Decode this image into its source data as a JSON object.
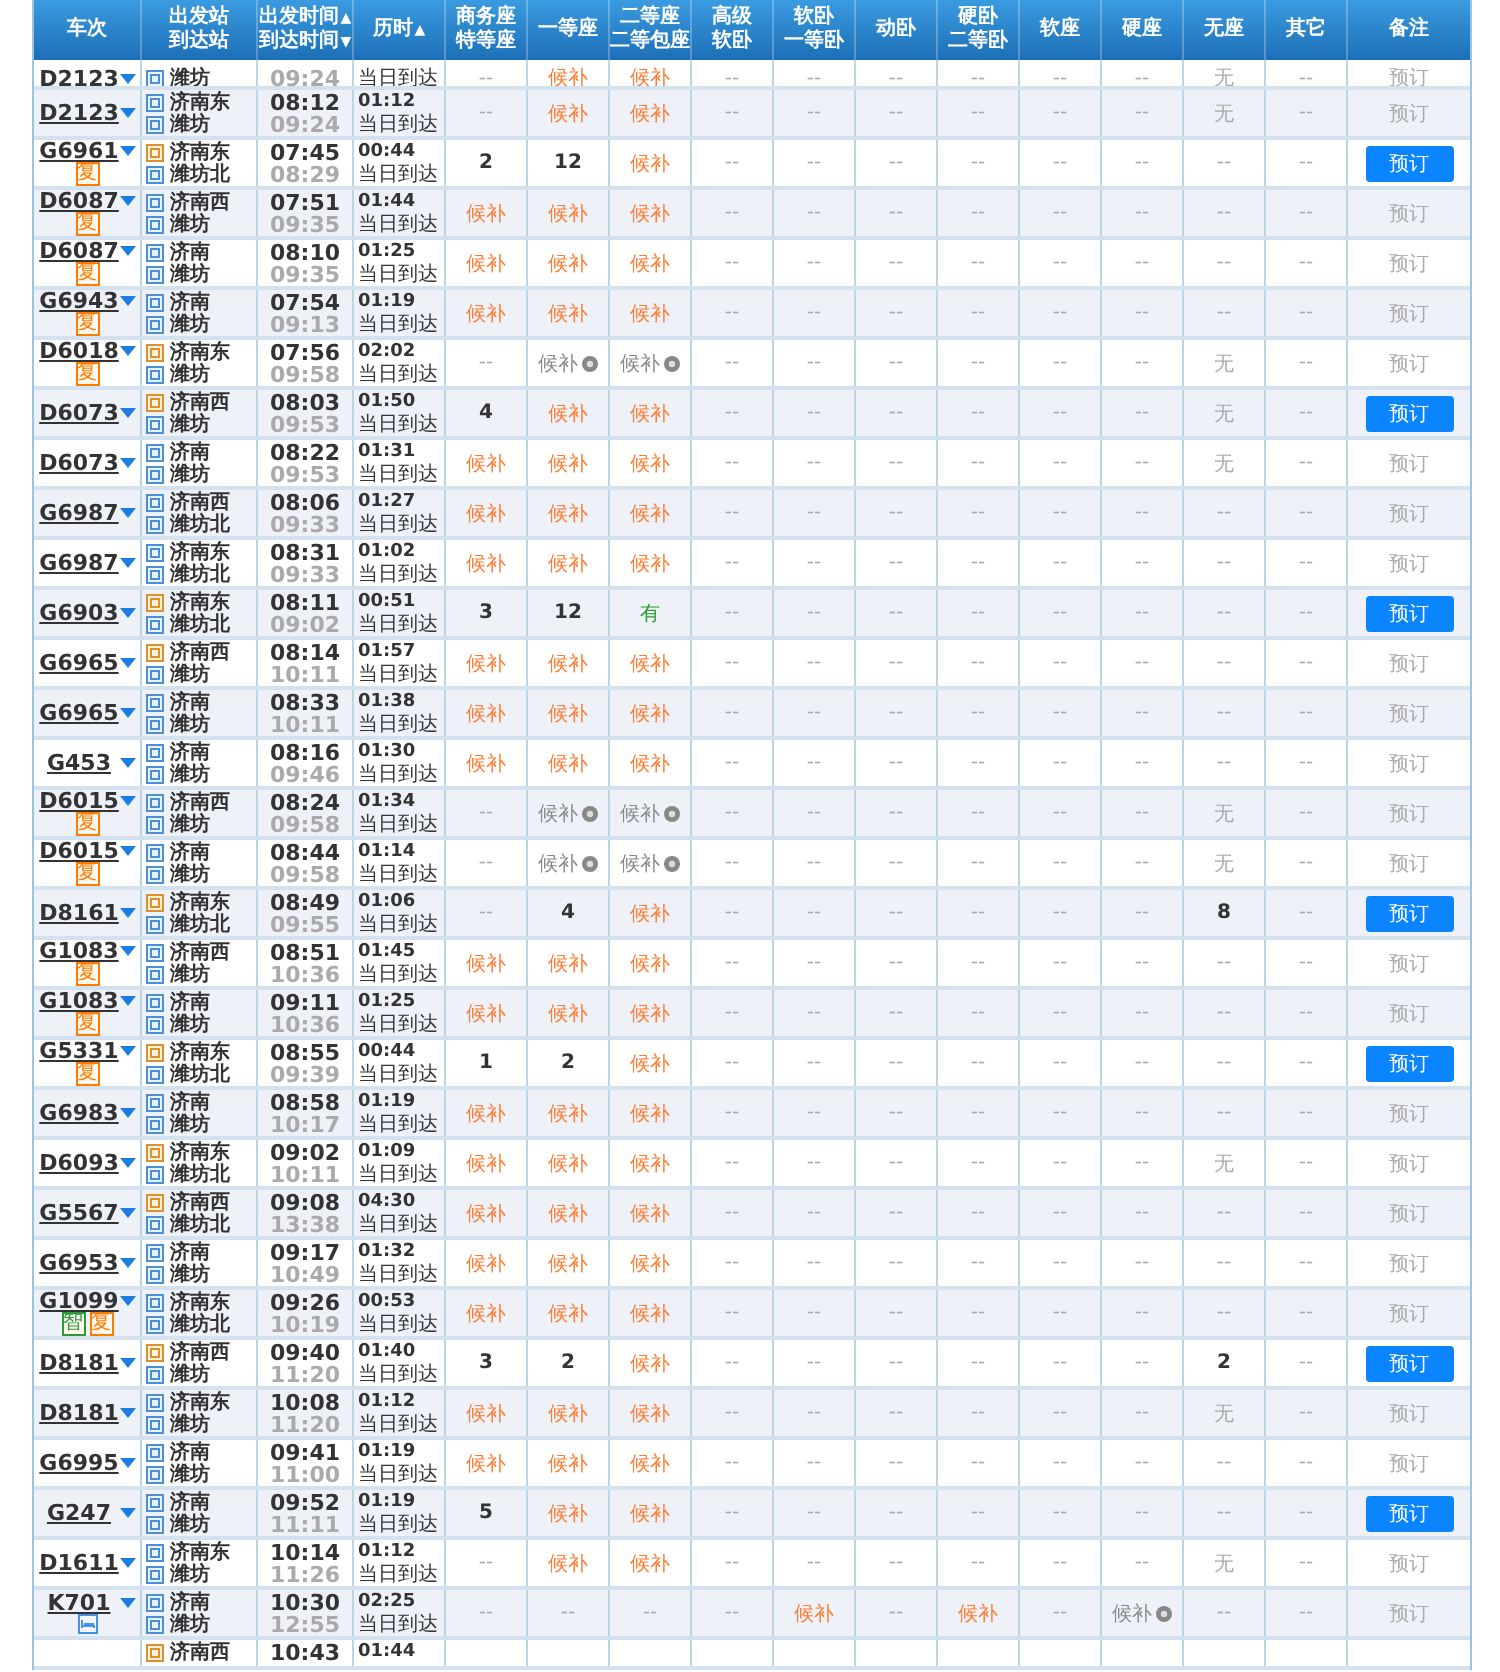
{
  "columns": [
    {
      "lines": [
        {
          "text": "车次"
        }
      ]
    },
    {
      "lines": [
        {
          "text": "出发站"
        },
        {
          "text": "到达站"
        }
      ]
    },
    {
      "lines": [
        {
          "text": "出发时间",
          "sort": "▲"
        },
        {
          "text": "到达时间",
          "sort": "▼"
        }
      ]
    },
    {
      "lines": [
        {
          "text": "历时",
          "sort": "▲"
        }
      ]
    },
    {
      "lines": [
        {
          "text": "商务座"
        },
        {
          "text": "特等座"
        }
      ]
    },
    {
      "lines": [
        {
          "text": "一等座"
        }
      ]
    },
    {
      "lines": [
        {
          "text": "二等座"
        },
        {
          "text": "二等包座"
        }
      ]
    },
    {
      "lines": [
        {
          "text": "高级"
        },
        {
          "text": "软卧"
        }
      ]
    },
    {
      "lines": [
        {
          "text": "软卧"
        },
        {
          "text": "一等卧"
        }
      ]
    },
    {
      "lines": [
        {
          "text": "动卧"
        }
      ]
    },
    {
      "lines": [
        {
          "text": "硬卧"
        },
        {
          "text": "二等卧"
        }
      ]
    },
    {
      "lines": [
        {
          "text": "软座"
        }
      ]
    },
    {
      "lines": [
        {
          "text": "硬座"
        }
      ]
    },
    {
      "lines": [
        {
          "text": "无座"
        }
      ]
    },
    {
      "lines": [
        {
          "text": "其它"
        }
      ]
    },
    {
      "lines": [
        {
          "text": "备注"
        }
      ]
    }
  ],
  "rows": [
    {
      "train": "D2123",
      "badges": [],
      "to": {
        "name": "潍坊",
        "kind": "pass"
      },
      "arrive": "09:24",
      "note": "当日到达",
      "seats": [
        {
          "text": "--",
          "kind": "none"
        },
        {
          "text": "候补",
          "kind": "wait"
        },
        {
          "text": "候补",
          "kind": "wait"
        },
        {
          "text": "--",
          "kind": "none"
        },
        {
          "text": "--",
          "kind": "none"
        },
        {
          "text": "--",
          "kind": "none"
        },
        {
          "text": "--",
          "kind": "none"
        },
        {
          "text": "--",
          "kind": "none"
        },
        {
          "text": "--",
          "kind": "none"
        },
        {
          "text": "无",
          "kind": "none"
        },
        {
          "text": "--",
          "kind": "none"
        }
      ],
      "book": {
        "label": "预订",
        "enabled": false
      }
    },
    {
      "train": "D2123",
      "badges": [],
      "from": {
        "name": "济南东",
        "kind": "pass"
      },
      "to": {
        "name": "潍坊",
        "kind": "pass"
      },
      "depart": "08:12",
      "arrive": "09:24",
      "duration": "01:12",
      "note": "当日到达",
      "seats": [
        {
          "text": "--",
          "kind": "none"
        },
        {
          "text": "候补",
          "kind": "wait"
        },
        {
          "text": "候补",
          "kind": "wait"
        },
        {
          "text": "--",
          "kind": "none"
        },
        {
          "text": "--",
          "kind": "none"
        },
        {
          "text": "--",
          "kind": "none"
        },
        {
          "text": "--",
          "kind": "none"
        },
        {
          "text": "--",
          "kind": "none"
        },
        {
          "text": "--",
          "kind": "none"
        },
        {
          "text": "无",
          "kind": "none"
        },
        {
          "text": "--",
          "kind": "none"
        }
      ],
      "book": {
        "label": "预订",
        "enabled": false
      }
    },
    {
      "train": "G6961",
      "badges": [
        {
          "text": "复",
          "color": "#ff7a00"
        }
      ],
      "from": {
        "name": "济南东",
        "kind": "start"
      },
      "to": {
        "name": "潍坊北",
        "kind": "pass"
      },
      "depart": "07:45",
      "arrive": "08:29",
      "duration": "00:44",
      "note": "当日到达",
      "seats": [
        {
          "text": "2",
          "kind": "count"
        },
        {
          "text": "12",
          "kind": "count"
        },
        {
          "text": "候补",
          "kind": "wait"
        },
        {
          "text": "--",
          "kind": "none"
        },
        {
          "text": "--",
          "kind": "none"
        },
        {
          "text": "--",
          "kind": "none"
        },
        {
          "text": "--",
          "kind": "none"
        },
        {
          "text": "--",
          "kind": "none"
        },
        {
          "text": "--",
          "kind": "none"
        },
        {
          "text": "--",
          "kind": "none"
        },
        {
          "text": "--",
          "kind": "none"
        }
      ],
      "book": {
        "label": "预订",
        "enabled": true
      }
    },
    {
      "train": "D6087",
      "badges": [
        {
          "text": "复",
          "color": "#ff7a00"
        }
      ],
      "from": {
        "name": "济南西",
        "kind": "pass"
      },
      "to": {
        "name": "潍坊",
        "kind": "pass"
      },
      "depart": "07:51",
      "arrive": "09:35",
      "duration": "01:44",
      "note": "当日到达",
      "seats": [
        {
          "text": "候补",
          "kind": "wait"
        },
        {
          "text": "候补",
          "kind": "wait"
        },
        {
          "text": "候补",
          "kind": "wait"
        },
        {
          "text": "--",
          "kind": "none"
        },
        {
          "text": "--",
          "kind": "none"
        },
        {
          "text": "--",
          "kind": "none"
        },
        {
          "text": "--",
          "kind": "none"
        },
        {
          "text": "--",
          "kind": "none"
        },
        {
          "text": "--",
          "kind": "none"
        },
        {
          "text": "--",
          "kind": "none"
        },
        {
          "text": "--",
          "kind": "none"
        }
      ],
      "book": {
        "label": "预订",
        "enabled": false
      }
    },
    {
      "train": "D6087",
      "badges": [
        {
          "text": "复",
          "color": "#ff7a00"
        }
      ],
      "from": {
        "name": "济南",
        "kind": "pass"
      },
      "to": {
        "name": "潍坊",
        "kind": "pass"
      },
      "depart": "08:10",
      "arrive": "09:35",
      "duration": "01:25",
      "note": "当日到达",
      "seats": [
        {
          "text": "候补",
          "kind": "wait"
        },
        {
          "text": "候补",
          "kind": "wait"
        },
        {
          "text": "候补",
          "kind": "wait"
        },
        {
          "text": "--",
          "kind": "none"
        },
        {
          "text": "--",
          "kind": "none"
        },
        {
          "text": "--",
          "kind": "none"
        },
        {
          "text": "--",
          "kind": "none"
        },
        {
          "text": "--",
          "kind": "none"
        },
        {
          "text": "--",
          "kind": "none"
        },
        {
          "text": "--",
          "kind": "none"
        },
        {
          "text": "--",
          "kind": "none"
        }
      ],
      "book": {
        "label": "预订",
        "enabled": false
      }
    },
    {
      "train": "G6943",
      "badges": [
        {
          "text": "复",
          "color": "#ff7a00"
        }
      ],
      "from": {
        "name": "济南",
        "kind": "pass"
      },
      "to": {
        "name": "潍坊",
        "kind": "pass"
      },
      "depart": "07:54",
      "arrive": "09:13",
      "duration": "01:19",
      "note": "当日到达",
      "seats": [
        {
          "text": "候补",
          "kind": "wait"
        },
        {
          "text": "候补",
          "kind": "wait"
        },
        {
          "text": "候补",
          "kind": "wait"
        },
        {
          "text": "--",
          "kind": "none"
        },
        {
          "text": "--",
          "kind": "none"
        },
        {
          "text": "--",
          "kind": "none"
        },
        {
          "text": "--",
          "kind": "none"
        },
        {
          "text": "--",
          "kind": "none"
        },
        {
          "text": "--",
          "kind": "none"
        },
        {
          "text": "--",
          "kind": "none"
        },
        {
          "text": "--",
          "kind": "none"
        }
      ],
      "book": {
        "label": "预订",
        "enabled": false
      }
    },
    {
      "train": "D6018",
      "badges": [
        {
          "text": "复",
          "color": "#ff7a00"
        }
      ],
      "from": {
        "name": "济南东",
        "kind": "start"
      },
      "to": {
        "name": "潍坊",
        "kind": "pass"
      },
      "depart": "07:56",
      "arrive": "09:58",
      "duration": "02:02",
      "note": "当日到达",
      "seats": [
        {
          "text": "--",
          "kind": "none"
        },
        {
          "text": "候补",
          "kind": "closed"
        },
        {
          "text": "候补",
          "kind": "closed"
        },
        {
          "text": "--",
          "kind": "none"
        },
        {
          "text": "--",
          "kind": "none"
        },
        {
          "text": "--",
          "kind": "none"
        },
        {
          "text": "--",
          "kind": "none"
        },
        {
          "text": "--",
          "kind": "none"
        },
        {
          "text": "--",
          "kind": "none"
        },
        {
          "text": "无",
          "kind": "none"
        },
        {
          "text": "--",
          "kind": "none"
        }
      ],
      "book": {
        "label": "预订",
        "enabled": false
      }
    },
    {
      "train": "D6073",
      "badges": [],
      "from": {
        "name": "济南西",
        "kind": "start"
      },
      "to": {
        "name": "潍坊",
        "kind": "pass"
      },
      "depart": "08:03",
      "arrive": "09:53",
      "duration": "01:50",
      "note": "当日到达",
      "seats": [
        {
          "text": "4",
          "kind": "count"
        },
        {
          "text": "候补",
          "kind": "wait"
        },
        {
          "text": "候补",
          "kind": "wait"
        },
        {
          "text": "--",
          "kind": "none"
        },
        {
          "text": "--",
          "kind": "none"
        },
        {
          "text": "--",
          "kind": "none"
        },
        {
          "text": "--",
          "kind": "none"
        },
        {
          "text": "--",
          "kind": "none"
        },
        {
          "text": "--",
          "kind": "none"
        },
        {
          "text": "无",
          "kind": "none"
        },
        {
          "text": "--",
          "kind": "none"
        }
      ],
      "book": {
        "label": "预订",
        "enabled": true
      }
    },
    {
      "train": "D6073",
      "badges": [],
      "from": {
        "name": "济南",
        "kind": "pass"
      },
      "to": {
        "name": "潍坊",
        "kind": "pass"
      },
      "depart": "08:22",
      "arrive": "09:53",
      "duration": "01:31",
      "note": "当日到达",
      "seats": [
        {
          "text": "候补",
          "kind": "wait"
        },
        {
          "text": "候补",
          "kind": "wait"
        },
        {
          "text": "候补",
          "kind": "wait"
        },
        {
          "text": "--",
          "kind": "none"
        },
        {
          "text": "--",
          "kind": "none"
        },
        {
          "text": "--",
          "kind": "none"
        },
        {
          "text": "--",
          "kind": "none"
        },
        {
          "text": "--",
          "kind": "none"
        },
        {
          "text": "--",
          "kind": "none"
        },
        {
          "text": "无",
          "kind": "none"
        },
        {
          "text": "--",
          "kind": "none"
        }
      ],
      "book": {
        "label": "预订",
        "enabled": false
      }
    },
    {
      "train": "G6987",
      "badges": [],
      "from": {
        "name": "济南西",
        "kind": "pass"
      },
      "to": {
        "name": "潍坊北",
        "kind": "pass"
      },
      "depart": "08:06",
      "arrive": "09:33",
      "duration": "01:27",
      "note": "当日到达",
      "seats": [
        {
          "text": "候补",
          "kind": "wait"
        },
        {
          "text": "候补",
          "kind": "wait"
        },
        {
          "text": "候补",
          "kind": "wait"
        },
        {
          "text": "--",
          "kind": "none"
        },
        {
          "text": "--",
          "kind": "none"
        },
        {
          "text": "--",
          "kind": "none"
        },
        {
          "text": "--",
          "kind": "none"
        },
        {
          "text": "--",
          "kind": "none"
        },
        {
          "text": "--",
          "kind": "none"
        },
        {
          "text": "--",
          "kind": "none"
        },
        {
          "text": "--",
          "kind": "none"
        }
      ],
      "book": {
        "label": "预订",
        "enabled": false
      }
    },
    {
      "train": "G6987",
      "badges": [],
      "from": {
        "name": "济南东",
        "kind": "pass"
      },
      "to": {
        "name": "潍坊北",
        "kind": "pass"
      },
      "depart": "08:31",
      "arrive": "09:33",
      "duration": "01:02",
      "note": "当日到达",
      "seats": [
        {
          "text": "候补",
          "kind": "wait"
        },
        {
          "text": "候补",
          "kind": "wait"
        },
        {
          "text": "候补",
          "kind": "wait"
        },
        {
          "text": "--",
          "kind": "none"
        },
        {
          "text": "--",
          "kind": "none"
        },
        {
          "text": "--",
          "kind": "none"
        },
        {
          "text": "--",
          "kind": "none"
        },
        {
          "text": "--",
          "kind": "none"
        },
        {
          "text": "--",
          "kind": "none"
        },
        {
          "text": "--",
          "kind": "none"
        },
        {
          "text": "--",
          "kind": "none"
        }
      ],
      "book": {
        "label": "预订",
        "enabled": false
      }
    },
    {
      "train": "G6903",
      "badges": [],
      "from": {
        "name": "济南东",
        "kind": "start"
      },
      "to": {
        "name": "潍坊北",
        "kind": "pass"
      },
      "depart": "08:11",
      "arrive": "09:02",
      "duration": "00:51",
      "note": "当日到达",
      "seats": [
        {
          "text": "3",
          "kind": "count"
        },
        {
          "text": "12",
          "kind": "count"
        },
        {
          "text": "有",
          "kind": "available"
        },
        {
          "text": "--",
          "kind": "none"
        },
        {
          "text": "--",
          "kind": "none"
        },
        {
          "text": "--",
          "kind": "none"
        },
        {
          "text": "--",
          "kind": "none"
        },
        {
          "text": "--",
          "kind": "none"
        },
        {
          "text": "--",
          "kind": "none"
        },
        {
          "text": "--",
          "kind": "none"
        },
        {
          "text": "--",
          "kind": "none"
        }
      ],
      "book": {
        "label": "预订",
        "enabled": true
      }
    },
    {
      "train": "G6965",
      "badges": [],
      "from": {
        "name": "济南西",
        "kind": "start"
      },
      "to": {
        "name": "潍坊",
        "kind": "pass"
      },
      "depart": "08:14",
      "arrive": "10:11",
      "duration": "01:57",
      "note": "当日到达",
      "seats": [
        {
          "text": "候补",
          "kind": "wait"
        },
        {
          "text": "候补",
          "kind": "wait"
        },
        {
          "text": "候补",
          "kind": "wait"
        },
        {
          "text": "--",
          "kind": "none"
        },
        {
          "text": "--",
          "kind": "none"
        },
        {
          "text": "--",
          "kind": "none"
        },
        {
          "text": "--",
          "kind": "none"
        },
        {
          "text": "--",
          "kind": "none"
        },
        {
          "text": "--",
          "kind": "none"
        },
        {
          "text": "--",
          "kind": "none"
        },
        {
          "text": "--",
          "kind": "none"
        }
      ],
      "book": {
        "label": "预订",
        "enabled": false
      }
    },
    {
      "train": "G6965",
      "badges": [],
      "from": {
        "name": "济南",
        "kind": "pass"
      },
      "to": {
        "name": "潍坊",
        "kind": "pass"
      },
      "depart": "08:33",
      "arrive": "10:11",
      "duration": "01:38",
      "note": "当日到达",
      "seats": [
        {
          "text": "候补",
          "kind": "wait"
        },
        {
          "text": "候补",
          "kind": "wait"
        },
        {
          "text": "候补",
          "kind": "wait"
        },
        {
          "text": "--",
          "kind": "none"
        },
        {
          "text": "--",
          "kind": "none"
        },
        {
          "text": "--",
          "kind": "none"
        },
        {
          "text": "--",
          "kind": "none"
        },
        {
          "text": "--",
          "kind": "none"
        },
        {
          "text": "--",
          "kind": "none"
        },
        {
          "text": "--",
          "kind": "none"
        },
        {
          "text": "--",
          "kind": "none"
        }
      ],
      "book": {
        "label": "预订",
        "enabled": false
      }
    },
    {
      "train": "G453",
      "badges": [],
      "from": {
        "name": "济南",
        "kind": "pass"
      },
      "to": {
        "name": "潍坊",
        "kind": "pass"
      },
      "depart": "08:16",
      "arrive": "09:46",
      "duration": "01:30",
      "note": "当日到达",
      "seats": [
        {
          "text": "候补",
          "kind": "wait"
        },
        {
          "text": "候补",
          "kind": "wait"
        },
        {
          "text": "候补",
          "kind": "wait"
        },
        {
          "text": "--",
          "kind": "none"
        },
        {
          "text": "--",
          "kind": "none"
        },
        {
          "text": "--",
          "kind": "none"
        },
        {
          "text": "--",
          "kind": "none"
        },
        {
          "text": "--",
          "kind": "none"
        },
        {
          "text": "--",
          "kind": "none"
        },
        {
          "text": "--",
          "kind": "none"
        },
        {
          "text": "--",
          "kind": "none"
        }
      ],
      "book": {
        "label": "预订",
        "enabled": false
      }
    },
    {
      "train": "D6015",
      "badges": [
        {
          "text": "复",
          "color": "#ff7a00"
        }
      ],
      "from": {
        "name": "济南西",
        "kind": "pass"
      },
      "to": {
        "name": "潍坊",
        "kind": "pass"
      },
      "depart": "08:24",
      "arrive": "09:58",
      "duration": "01:34",
      "note": "当日到达",
      "seats": [
        {
          "text": "--",
          "kind": "none"
        },
        {
          "text": "候补",
          "kind": "closed"
        },
        {
          "text": "候补",
          "kind": "closed"
        },
        {
          "text": "--",
          "kind": "none"
        },
        {
          "text": "--",
          "kind": "none"
        },
        {
          "text": "--",
          "kind": "none"
        },
        {
          "text": "--",
          "kind": "none"
        },
        {
          "text": "--",
          "kind": "none"
        },
        {
          "text": "--",
          "kind": "none"
        },
        {
          "text": "无",
          "kind": "none"
        },
        {
          "text": "--",
          "kind": "none"
        }
      ],
      "book": {
        "label": "预订",
        "enabled": false
      }
    },
    {
      "train": "D6015",
      "badges": [
        {
          "text": "复",
          "color": "#ff7a00"
        }
      ],
      "from": {
        "name": "济南",
        "kind": "pass"
      },
      "to": {
        "name": "潍坊",
        "kind": "pass"
      },
      "depart": "08:44",
      "arrive": "09:58",
      "duration": "01:14",
      "note": "当日到达",
      "seats": [
        {
          "text": "--",
          "kind": "none"
        },
        {
          "text": "候补",
          "kind": "closed"
        },
        {
          "text": "候补",
          "kind": "closed"
        },
        {
          "text": "--",
          "kind": "none"
        },
        {
          "text": "--",
          "kind": "none"
        },
        {
          "text": "--",
          "kind": "none"
        },
        {
          "text": "--",
          "kind": "none"
        },
        {
          "text": "--",
          "kind": "none"
        },
        {
          "text": "--",
          "kind": "none"
        },
        {
          "text": "无",
          "kind": "none"
        },
        {
          "text": "--",
          "kind": "none"
        }
      ],
      "book": {
        "label": "预订",
        "enabled": false
      }
    },
    {
      "train": "D8161",
      "badges": [],
      "from": {
        "name": "济南东",
        "kind": "start"
      },
      "to": {
        "name": "潍坊北",
        "kind": "pass"
      },
      "depart": "08:49",
      "arrive": "09:55",
      "duration": "01:06",
      "note": "当日到达",
      "seats": [
        {
          "text": "--",
          "kind": "none"
        },
        {
          "text": "4",
          "kind": "count"
        },
        {
          "text": "候补",
          "kind": "wait"
        },
        {
          "text": "--",
          "kind": "none"
        },
        {
          "text": "--",
          "kind": "none"
        },
        {
          "text": "--",
          "kind": "none"
        },
        {
          "text": "--",
          "kind": "none"
        },
        {
          "text": "--",
          "kind": "none"
        },
        {
          "text": "--",
          "kind": "none"
        },
        {
          "text": "8",
          "kind": "count"
        },
        {
          "text": "--",
          "kind": "none"
        }
      ],
      "book": {
        "label": "预订",
        "enabled": true
      }
    },
    {
      "train": "G1083",
      "badges": [
        {
          "text": "复",
          "color": "#ff7a00"
        }
      ],
      "from": {
        "name": "济南西",
        "kind": "pass"
      },
      "to": {
        "name": "潍坊",
        "kind": "pass"
      },
      "depart": "08:51",
      "arrive": "10:36",
      "duration": "01:45",
      "note": "当日到达",
      "seats": [
        {
          "text": "候补",
          "kind": "wait"
        },
        {
          "text": "候补",
          "kind": "wait"
        },
        {
          "text": "候补",
          "kind": "wait"
        },
        {
          "text": "--",
          "kind": "none"
        },
        {
          "text": "--",
          "kind": "none"
        },
        {
          "text": "--",
          "kind": "none"
        },
        {
          "text": "--",
          "kind": "none"
        },
        {
          "text": "--",
          "kind": "none"
        },
        {
          "text": "--",
          "kind": "none"
        },
        {
          "text": "--",
          "kind": "none"
        },
        {
          "text": "--",
          "kind": "none"
        }
      ],
      "book": {
        "label": "预订",
        "enabled": false
      }
    },
    {
      "train": "G1083",
      "badges": [
        {
          "text": "复",
          "color": "#ff7a00"
        }
      ],
      "from": {
        "name": "济南",
        "kind": "pass"
      },
      "to": {
        "name": "潍坊",
        "kind": "pass"
      },
      "depart": "09:11",
      "arrive": "10:36",
      "duration": "01:25",
      "note": "当日到达",
      "seats": [
        {
          "text": "候补",
          "kind": "wait"
        },
        {
          "text": "候补",
          "kind": "wait"
        },
        {
          "text": "候补",
          "kind": "wait"
        },
        {
          "text": "--",
          "kind": "none"
        },
        {
          "text": "--",
          "kind": "none"
        },
        {
          "text": "--",
          "kind": "none"
        },
        {
          "text": "--",
          "kind": "none"
        },
        {
          "text": "--",
          "kind": "none"
        },
        {
          "text": "--",
          "kind": "none"
        },
        {
          "text": "--",
          "kind": "none"
        },
        {
          "text": "--",
          "kind": "none"
        }
      ],
      "book": {
        "label": "预订",
        "enabled": false
      }
    },
    {
      "train": "G5331",
      "badges": [
        {
          "text": "复",
          "color": "#ff7a00"
        }
      ],
      "from": {
        "name": "济南东",
        "kind": "start"
      },
      "to": {
        "name": "潍坊北",
        "kind": "pass"
      },
      "depart": "08:55",
      "arrive": "09:39",
      "duration": "00:44",
      "note": "当日到达",
      "seats": [
        {
          "text": "1",
          "kind": "count"
        },
        {
          "text": "2",
          "kind": "count"
        },
        {
          "text": "候补",
          "kind": "wait"
        },
        {
          "text": "--",
          "kind": "none"
        },
        {
          "text": "--",
          "kind": "none"
        },
        {
          "text": "--",
          "kind": "none"
        },
        {
          "text": "--",
          "kind": "none"
        },
        {
          "text": "--",
          "kind": "none"
        },
        {
          "text": "--",
          "kind": "none"
        },
        {
          "text": "--",
          "kind": "none"
        },
        {
          "text": "--",
          "kind": "none"
        }
      ],
      "book": {
        "label": "预订",
        "enabled": true
      }
    },
    {
      "train": "G6983",
      "badges": [],
      "from": {
        "name": "济南",
        "kind": "pass"
      },
      "to": {
        "name": "潍坊",
        "kind": "pass"
      },
      "depart": "08:58",
      "arrive": "10:17",
      "duration": "01:19",
      "note": "当日到达",
      "seats": [
        {
          "text": "候补",
          "kind": "wait"
        },
        {
          "text": "候补",
          "kind": "wait"
        },
        {
          "text": "候补",
          "kind": "wait"
        },
        {
          "text": "--",
          "kind": "none"
        },
        {
          "text": "--",
          "kind": "none"
        },
        {
          "text": "--",
          "kind": "none"
        },
        {
          "text": "--",
          "kind": "none"
        },
        {
          "text": "--",
          "kind": "none"
        },
        {
          "text": "--",
          "kind": "none"
        },
        {
          "text": "--",
          "kind": "none"
        },
        {
          "text": "--",
          "kind": "none"
        }
      ],
      "book": {
        "label": "预订",
        "enabled": false
      }
    },
    {
      "train": "D6093",
      "badges": [],
      "from": {
        "name": "济南东",
        "kind": "start"
      },
      "to": {
        "name": "潍坊北",
        "kind": "pass"
      },
      "depart": "09:02",
      "arrive": "10:11",
      "duration": "01:09",
      "note": "当日到达",
      "seats": [
        {
          "text": "候补",
          "kind": "wait"
        },
        {
          "text": "候补",
          "kind": "wait"
        },
        {
          "text": "候补",
          "kind": "wait"
        },
        {
          "text": "--",
          "kind": "none"
        },
        {
          "text": "--",
          "kind": "none"
        },
        {
          "text": "--",
          "kind": "none"
        },
        {
          "text": "--",
          "kind": "none"
        },
        {
          "text": "--",
          "kind": "none"
        },
        {
          "text": "--",
          "kind": "none"
        },
        {
          "text": "无",
          "kind": "none"
        },
        {
          "text": "--",
          "kind": "none"
        }
      ],
      "book": {
        "label": "预订",
        "enabled": false
      }
    },
    {
      "train": "G5567",
      "badges": [],
      "from": {
        "name": "济南西",
        "kind": "start"
      },
      "to": {
        "name": "潍坊北",
        "kind": "pass"
      },
      "depart": "09:08",
      "arrive": "13:38",
      "duration": "04:30",
      "note": "当日到达",
      "seats": [
        {
          "text": "候补",
          "kind": "wait"
        },
        {
          "text": "候补",
          "kind": "wait"
        },
        {
          "text": "候补",
          "kind": "wait"
        },
        {
          "text": "--",
          "kind": "none"
        },
        {
          "text": "--",
          "kind": "none"
        },
        {
          "text": "--",
          "kind": "none"
        },
        {
          "text": "--",
          "kind": "none"
        },
        {
          "text": "--",
          "kind": "none"
        },
        {
          "text": "--",
          "kind": "none"
        },
        {
          "text": "--",
          "kind": "none"
        },
        {
          "text": "--",
          "kind": "none"
        }
      ],
      "book": {
        "label": "预订",
        "enabled": false
      }
    },
    {
      "train": "G6953",
      "badges": [],
      "from": {
        "name": "济南",
        "kind": "pass"
      },
      "to": {
        "name": "潍坊",
        "kind": "pass"
      },
      "depart": "09:17",
      "arrive": "10:49",
      "duration": "01:32",
      "note": "当日到达",
      "seats": [
        {
          "text": "候补",
          "kind": "wait"
        },
        {
          "text": "候补",
          "kind": "wait"
        },
        {
          "text": "候补",
          "kind": "wait"
        },
        {
          "text": "--",
          "kind": "none"
        },
        {
          "text": "--",
          "kind": "none"
        },
        {
          "text": "--",
          "kind": "none"
        },
        {
          "text": "--",
          "kind": "none"
        },
        {
          "text": "--",
          "kind": "none"
        },
        {
          "text": "--",
          "kind": "none"
        },
        {
          "text": "--",
          "kind": "none"
        },
        {
          "text": "--",
          "kind": "none"
        }
      ],
      "book": {
        "label": "预订",
        "enabled": false
      }
    },
    {
      "train": "G1099",
      "badges": [
        {
          "text": "智",
          "color": "#2e9a3c"
        },
        {
          "text": "复",
          "color": "#ff7a00"
        }
      ],
      "from": {
        "name": "济南东",
        "kind": "pass"
      },
      "to": {
        "name": "潍坊北",
        "kind": "pass"
      },
      "depart": "09:26",
      "arrive": "10:19",
      "duration": "00:53",
      "note": "当日到达",
      "seats": [
        {
          "text": "候补",
          "kind": "wait"
        },
        {
          "text": "候补",
          "kind": "wait"
        },
        {
          "text": "候补",
          "kind": "wait"
        },
        {
          "text": "--",
          "kind": "none"
        },
        {
          "text": "--",
          "kind": "none"
        },
        {
          "text": "--",
          "kind": "none"
        },
        {
          "text": "--",
          "kind": "none"
        },
        {
          "text": "--",
          "kind": "none"
        },
        {
          "text": "--",
          "kind": "none"
        },
        {
          "text": "--",
          "kind": "none"
        },
        {
          "text": "--",
          "kind": "none"
        }
      ],
      "book": {
        "label": "预订",
        "enabled": false
      }
    },
    {
      "train": "D8181",
      "badges": [],
      "from": {
        "name": "济南西",
        "kind": "start"
      },
      "to": {
        "name": "潍坊",
        "kind": "pass"
      },
      "depart": "09:40",
      "arrive": "11:20",
      "duration": "01:40",
      "note": "当日到达",
      "seats": [
        {
          "text": "3",
          "kind": "count"
        },
        {
          "text": "2",
          "kind": "count"
        },
        {
          "text": "候补",
          "kind": "wait"
        },
        {
          "text": "--",
          "kind": "none"
        },
        {
          "text": "--",
          "kind": "none"
        },
        {
          "text": "--",
          "kind": "none"
        },
        {
          "text": "--",
          "kind": "none"
        },
        {
          "text": "--",
          "kind": "none"
        },
        {
          "text": "--",
          "kind": "none"
        },
        {
          "text": "2",
          "kind": "count"
        },
        {
          "text": "--",
          "kind": "none"
        }
      ],
      "book": {
        "label": "预订",
        "enabled": true
      }
    },
    {
      "train": "D8181",
      "badges": [],
      "from": {
        "name": "济南东",
        "kind": "pass"
      },
      "to": {
        "name": "潍坊",
        "kind": "pass"
      },
      "depart": "10:08",
      "arrive": "11:20",
      "duration": "01:12",
      "note": "当日到达",
      "seats": [
        {
          "text": "候补",
          "kind": "wait"
        },
        {
          "text": "候补",
          "kind": "wait"
        },
        {
          "text": "候补",
          "kind": "wait"
        },
        {
          "text": "--",
          "kind": "none"
        },
        {
          "text": "--",
          "kind": "none"
        },
        {
          "text": "--",
          "kind": "none"
        },
        {
          "text": "--",
          "kind": "none"
        },
        {
          "text": "--",
          "kind": "none"
        },
        {
          "text": "--",
          "kind": "none"
        },
        {
          "text": "无",
          "kind": "none"
        },
        {
          "text": "--",
          "kind": "none"
        }
      ],
      "book": {
        "label": "预订",
        "enabled": false
      }
    },
    {
      "train": "G6995",
      "badges": [],
      "from": {
        "name": "济南",
        "kind": "pass"
      },
      "to": {
        "name": "潍坊",
        "kind": "pass"
      },
      "depart": "09:41",
      "arrive": "11:00",
      "duration": "01:19",
      "note": "当日到达",
      "seats": [
        {
          "text": "候补",
          "kind": "wait"
        },
        {
          "text": "候补",
          "kind": "wait"
        },
        {
          "text": "候补",
          "kind": "wait"
        },
        {
          "text": "--",
          "kind": "none"
        },
        {
          "text": "--",
          "kind": "none"
        },
        {
          "text": "--",
          "kind": "none"
        },
        {
          "text": "--",
          "kind": "none"
        },
        {
          "text": "--",
          "kind": "none"
        },
        {
          "text": "--",
          "kind": "none"
        },
        {
          "text": "--",
          "kind": "none"
        },
        {
          "text": "--",
          "kind": "none"
        }
      ],
      "book": {
        "label": "预订",
        "enabled": false
      }
    },
    {
      "train": "G247",
      "badges": [],
      "from": {
        "name": "济南",
        "kind": "pass"
      },
      "to": {
        "name": "潍坊",
        "kind": "pass"
      },
      "depart": "09:52",
      "arrive": "11:11",
      "duration": "01:19",
      "note": "当日到达",
      "seats": [
        {
          "text": "5",
          "kind": "count"
        },
        {
          "text": "候补",
          "kind": "wait"
        },
        {
          "text": "候补",
          "kind": "wait"
        },
        {
          "text": "--",
          "kind": "none"
        },
        {
          "text": "--",
          "kind": "none"
        },
        {
          "text": "--",
          "kind": "none"
        },
        {
          "text": "--",
          "kind": "none"
        },
        {
          "text": "--",
          "kind": "none"
        },
        {
          "text": "--",
          "kind": "none"
        },
        {
          "text": "--",
          "kind": "none"
        },
        {
          "text": "--",
          "kind": "none"
        }
      ],
      "book": {
        "label": "预订",
        "enabled": true
      }
    },
    {
      "train": "D1611",
      "badges": [],
      "from": {
        "name": "济南东",
        "kind": "pass"
      },
      "to": {
        "name": "潍坊",
        "kind": "pass"
      },
      "depart": "10:14",
      "arrive": "11:26",
      "duration": "01:12",
      "note": "当日到达",
      "seats": [
        {
          "text": "--",
          "kind": "none"
        },
        {
          "text": "候补",
          "kind": "wait"
        },
        {
          "text": "候补",
          "kind": "wait"
        },
        {
          "text": "--",
          "kind": "none"
        },
        {
          "text": "--",
          "kind": "none"
        },
        {
          "text": "--",
          "kind": "none"
        },
        {
          "text": "--",
          "kind": "none"
        },
        {
          "text": "--",
          "kind": "none"
        },
        {
          "text": "--",
          "kind": "none"
        },
        {
          "text": "无",
          "kind": "none"
        },
        {
          "text": "--",
          "kind": "none"
        }
      ],
      "book": {
        "label": "预订",
        "enabled": false
      }
    },
    {
      "train": "K701",
      "badges": [
        {
          "color": "#4a90e2"
        }
      ],
      "from": {
        "name": "济南",
        "kind": "pass"
      },
      "to": {
        "name": "潍坊",
        "kind": "pass"
      },
      "depart": "10:30",
      "arrive": "12:55",
      "duration": "02:25",
      "note": "当日到达",
      "seats": [
        {
          "text": "--",
          "kind": "none"
        },
        {
          "text": "--",
          "kind": "none"
        },
        {
          "text": "--",
          "kind": "none"
        },
        {
          "text": "--",
          "kind": "none"
        },
        {
          "text": "候补",
          "kind": "wait"
        },
        {
          "text": "--",
          "kind": "none"
        },
        {
          "text": "候补",
          "kind": "wait"
        },
        {
          "text": "--",
          "kind": "none"
        },
        {
          "text": "候补",
          "kind": "closed"
        },
        {
          "text": "--",
          "kind": "none"
        },
        {
          "text": "--",
          "kind": "none"
        }
      ],
      "book": {
        "label": "预订",
        "enabled": false
      }
    },
    {
      "badges": [],
      "from": {
        "name": "济南西",
        "kind": "start"
      },
      "depart": "10:43",
      "duration": "01:44"
    }
  ]
}
